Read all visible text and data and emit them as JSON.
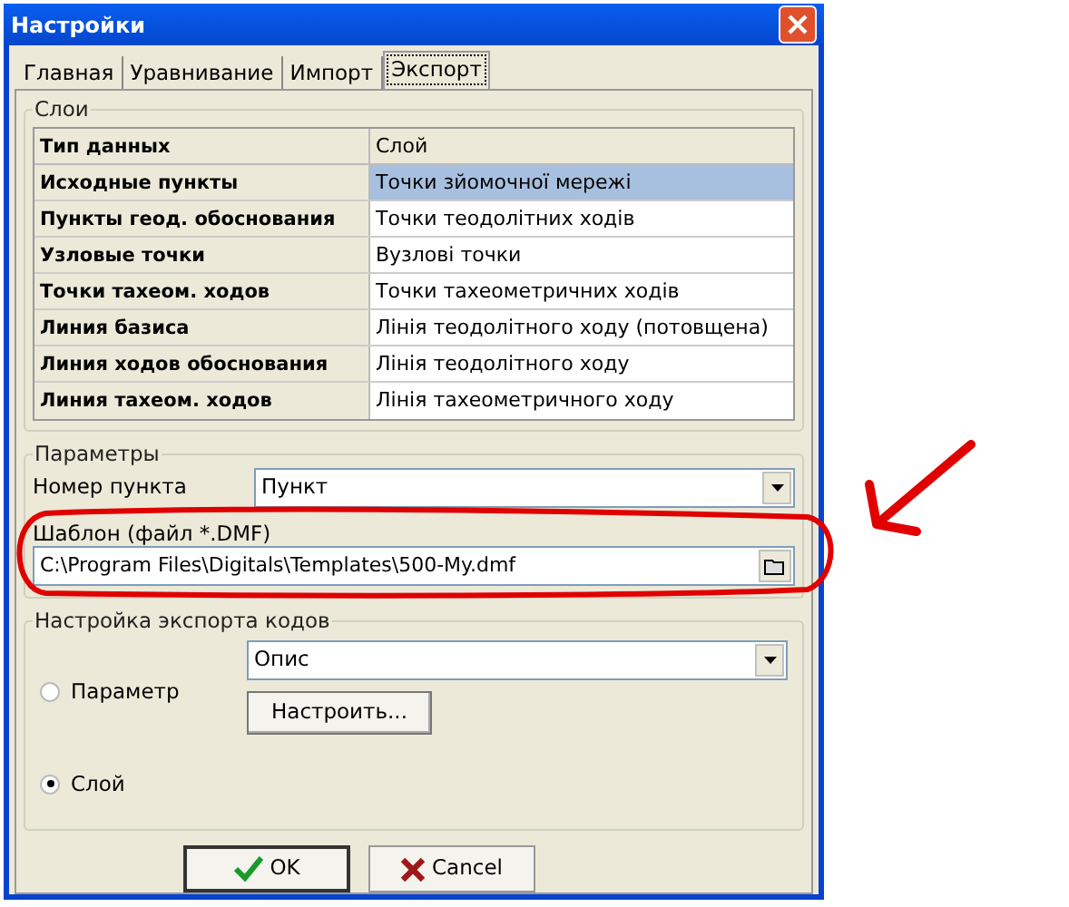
{
  "window": {
    "title": "Настройки"
  },
  "tabs": [
    {
      "label": "Главная",
      "selected": false
    },
    {
      "label": "Уравнивание",
      "selected": false
    },
    {
      "label": "Импорт",
      "selected": false
    },
    {
      "label": "Экспорт",
      "selected": true
    }
  ],
  "layers": {
    "title": "Слои",
    "columns": [
      "Тип данных",
      "Слой"
    ],
    "rows": [
      {
        "type": "Исходные пункты",
        "layer": "Точки зйомочної мережі",
        "selected": true
      },
      {
        "type": "Пункты геод. обоснования",
        "layer": "Точки теодолітних ходів",
        "selected": false
      },
      {
        "type": "Узловые точки",
        "layer": "Вузлові точки",
        "selected": false
      },
      {
        "type": "Точки тахеом. ходов",
        "layer": "Точки тахеометричних ходів",
        "selected": false
      },
      {
        "type": "Линия базиса",
        "layer": "Лінія теодолітного ходу (потовщена)",
        "selected": false
      },
      {
        "type": "Линия ходов обоснования",
        "layer": "Лінія теодолітного ходу",
        "selected": false
      },
      {
        "type": "Линия тахеом. ходов",
        "layer": "Лінія тахеометричного ходу",
        "selected": false
      }
    ]
  },
  "parameters": {
    "title": "Параметры",
    "point_number": {
      "label": "Номер пункта",
      "value": "Пункт"
    },
    "template": {
      "label": "Шаблон (файл *.DMF)",
      "value": "C:\\Program Files\\Digitals\\Templates\\500-My.dmf"
    }
  },
  "code_export": {
    "title": "Настройка экспорта кодов",
    "options": [
      {
        "label": "Параметр",
        "selected": false
      },
      {
        "label": "Слой",
        "selected": true
      }
    ],
    "parameter_value": "Опис",
    "configure_button": "Настроить..."
  },
  "buttons": [
    {
      "kind": "ok",
      "label": "OK"
    },
    {
      "kind": "cancel",
      "label": "Cancel"
    }
  ]
}
